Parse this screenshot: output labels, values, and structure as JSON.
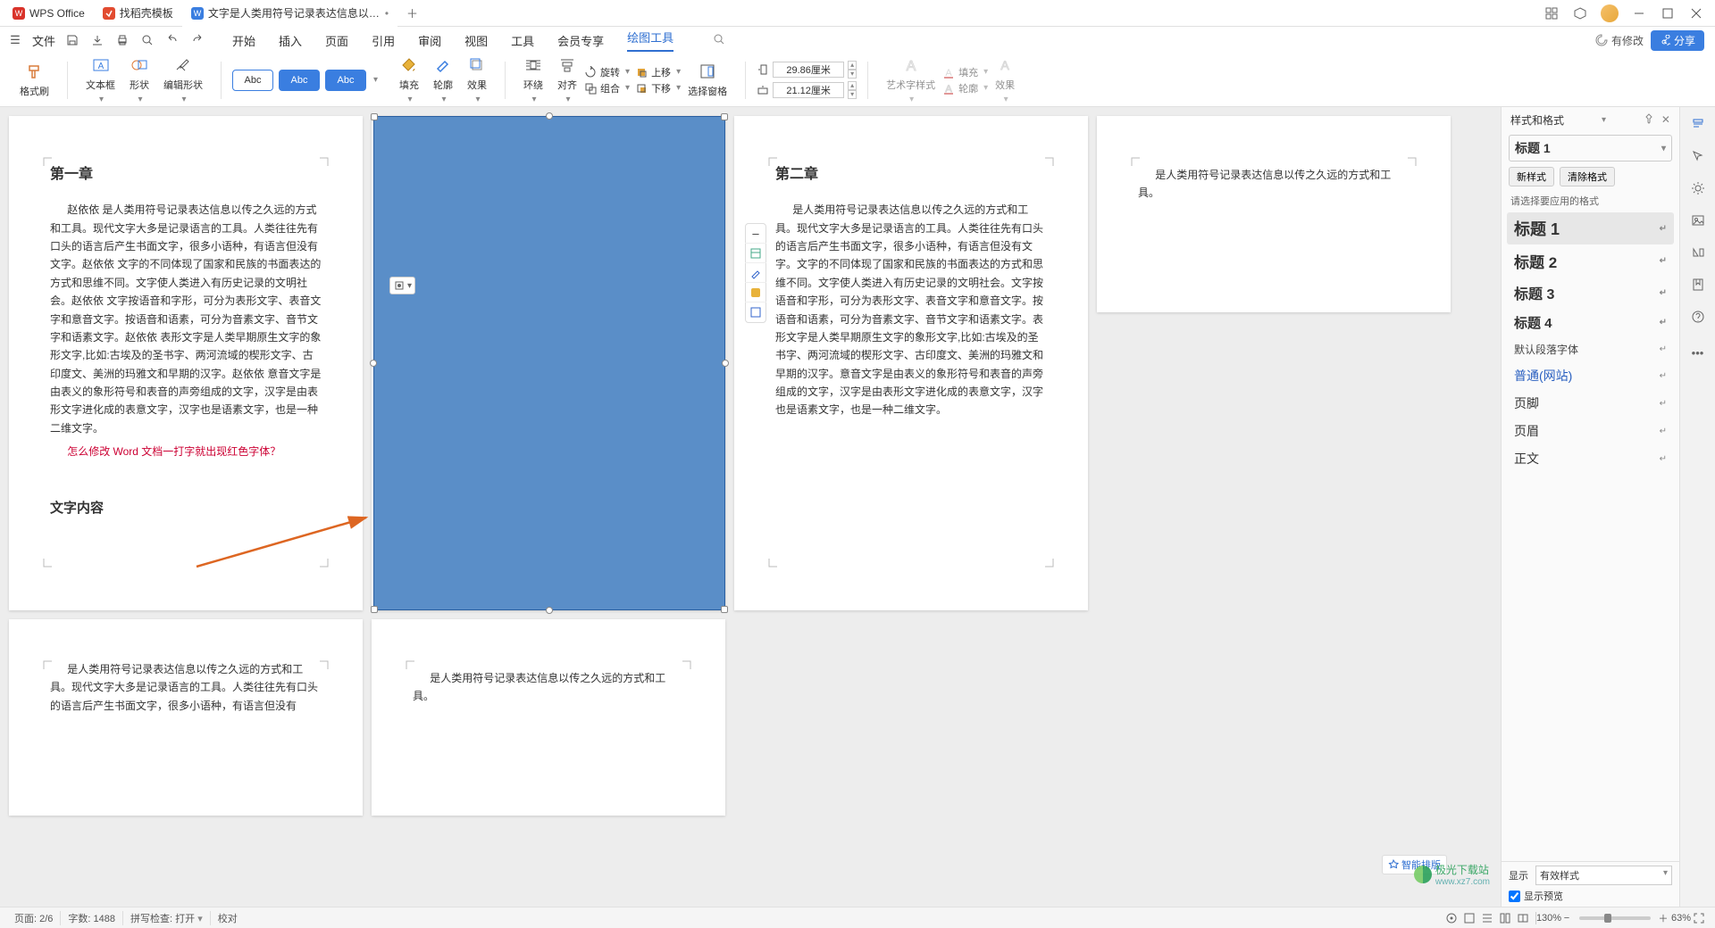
{
  "titlebar": {
    "tab1": "WPS Office",
    "tab2": "找稻壳模板",
    "tab3": "文字是人类用符号记录表达信息以…"
  },
  "menubar": {
    "file": "文件",
    "items": [
      "开始",
      "插入",
      "页面",
      "引用",
      "审阅",
      "视图",
      "工具",
      "会员专享",
      "绘图工具"
    ],
    "modified": "有修改",
    "share": "分享"
  },
  "ribbon": {
    "brush": "格式刷",
    "textbox": "文本框",
    "shape": "形状",
    "editshape": "编辑形状",
    "abc": "Abc",
    "fill": "填充",
    "outline": "轮廓",
    "effect": "效果",
    "wrap": "环绕",
    "align": "对齐",
    "group": "组合",
    "rotate": "旋转",
    "movef": "上移",
    "moveb": "下移",
    "selpane": "选择窗格",
    "h": "29.86厘米",
    "w": "21.12厘米",
    "artstyle": "艺术字样式",
    "outline2": "轮廓",
    "effect2": "效果",
    "fill2": "填充"
  },
  "doc": {
    "p1_title": "第一章",
    "p1_body": "赵依依 是人类用符号记录表达信息以传之久远的方式和工具。现代文字大多是记录语言的工具。人类往往先有口头的语言后产生书面文字，很多小语种，有语言但没有文字。赵依依 文字的不同体现了国家和民族的书面表达的方式和思维不同。文字使人类进入有历史记录的文明社会。赵依依 文字按语音和字形，可分为表形文字、表音文字和意音文字。按语音和语素，可分为音素文字、音节文字和语素文字。赵依依 表形文字是人类早期原生文字的象形文字,比如:古埃及的圣书字、两河流域的楔形文字、古印度文、美洲的玛雅文和早期的汉字。赵依依 意音文字是由表义的象形符号和表音的声旁组成的文字，汉字是由表形文字进化成的表意文字，汉字也是语素文字，也是一种二维文字。",
    "p1_q": "怎么修改 Word 文档一打字就出现红色字体？",
    "p1_section": "文字内容",
    "p2_title": "第二章",
    "p2_body": "是人类用符号记录表达信息以传之久远的方式和工具。现代文字大多是记录语言的工具。人类往往先有口头的语言后产生书面文字，很多小语种，有语言但没有文字。文字的不同体现了国家和民族的书面表达的方式和思维不同。文字使人类进入有历史记录的文明社会。文字按语音和字形，可分为表形文字、表音文字和意音文字。按语音和语素，可分为音素文字、音节文字和语素文字。表形文字是人类早期原生文字的象形文字,比如:古埃及的圣书字、两河流域的楔形文字、古印度文、美洲的玛雅文和早期的汉字。意音文字是由表义的象形符号和表音的声旁组成的文字，汉字是由表形文字进化成的表意文字，汉字也是语素文字，也是一种二维文字。",
    "p3_body": "是人类用符号记录表达信息以传之久远的方式和工具。",
    "p4_body": "是人类用符号记录表达信息以传之久远的方式和工具。现代文字大多是记录语言的工具。人类往往先有口头的语言后产生书面文字，很多小语种，有语言但没有",
    "p5_body": "是人类用符号记录表达信息以传之久远的方式和工具。"
  },
  "rightpane": {
    "header": "样式和格式",
    "current": "标题 1",
    "btn_new": "新样式",
    "btn_clear": "清除格式",
    "hint": "请选择要应用的格式",
    "styles": [
      {
        "label": "标题 1",
        "cls": "h1",
        "sel": true
      },
      {
        "label": "标题 2",
        "cls": "h2"
      },
      {
        "label": "标题 3",
        "cls": "h3"
      },
      {
        "label": "标题 4",
        "cls": "h4"
      },
      {
        "label": "默认段落字体",
        "cls": "small"
      },
      {
        "label": "普通(网站)",
        "cls": "blue"
      },
      {
        "label": "页脚",
        "cls": ""
      },
      {
        "label": "页眉",
        "cls": ""
      },
      {
        "label": "正文",
        "cls": ""
      }
    ],
    "show_label": "显示",
    "show_opt": "有效样式",
    "preview": "显示预览",
    "smart": "智能排版"
  },
  "statusbar": {
    "page": "页面: 2/6",
    "words": "字数: 1488",
    "spell": "拼写检查: 打开",
    "proof": "校对",
    "zoom": "63%",
    "scale": "130%"
  },
  "watermark": {
    "t1": "极光下载站",
    "t2": "www.xz7.com"
  }
}
